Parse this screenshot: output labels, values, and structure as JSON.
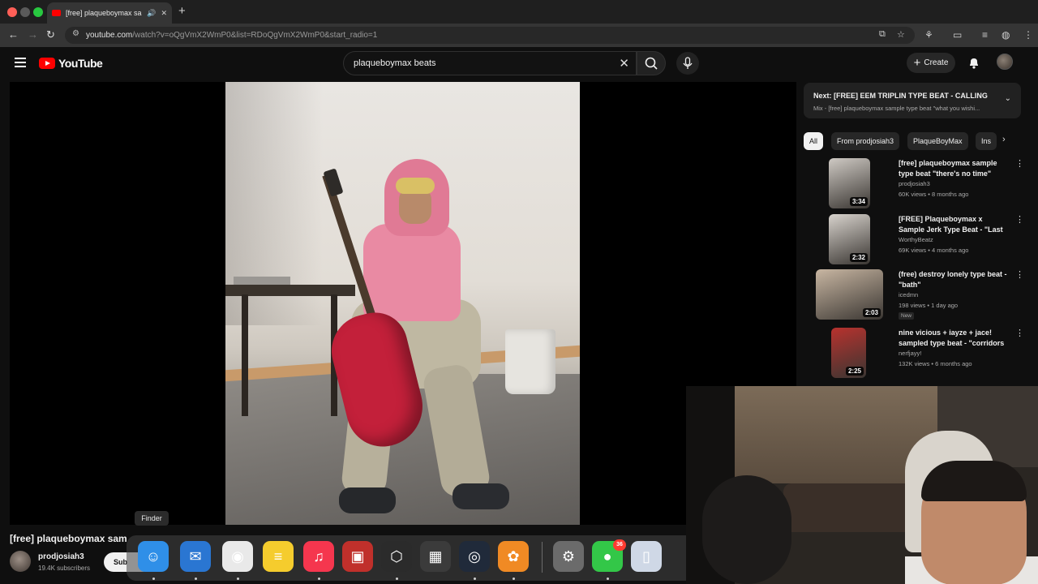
{
  "browser": {
    "tab_title": "[free] plaqueboymax sam",
    "url_host": "youtube.com",
    "url_path": "/watch?v=oQgVmX2WmP0&list=RDoQgVmX2WmP0&start_radio=1"
  },
  "masthead": {
    "logo_text": "YouTube",
    "search_value": "plaqueboymax beats",
    "create_label": "Create"
  },
  "video": {
    "title_truncated": "[free] plaqueboymax sam",
    "channel": "prodjosiah3",
    "subscribers": "19.4K subscribers",
    "subscribe_label": "Sub"
  },
  "up_next": {
    "title": "Next: [FREE] EEM TRIPLIN TYPE BEAT - CALLING",
    "subtitle": "Mix - [free] plaqueboymax sample type beat \"what you wishi..."
  },
  "chips": [
    "All",
    "From prodjosiah3",
    "PlaqueBoyMax",
    "Ins"
  ],
  "recommendations": [
    {
      "title": "[free] plaqueboymax sample type beat \"there's no time\"",
      "channel": "prodjosiah3",
      "meta": "60K views • 8 months ago",
      "duration": "3:34",
      "thumb_color": "#cfcac4",
      "new": ""
    },
    {
      "title": "[FREE] Plaqueboymax x Sample Jerk Type Beat - \"Last Friday ...",
      "channel": "WorthyBeatz",
      "meta": "69K views • 4 months ago",
      "duration": "2:32",
      "thumb_color": "#d8d3cd",
      "new": ""
    },
    {
      "title": "(free) destroy lonely type beat - \"bath\"",
      "channel": "icedmn",
      "meta": "198 views • 1 day ago",
      "duration": "2:03",
      "thumb_color": "#c8b6a2",
      "new": "New"
    },
    {
      "title": "nine vicious + iayze + jace! sampled type beat - \"corridors ...",
      "channel": "nerfjayy!",
      "meta": "132K views • 6 months ago",
      "duration": "2:25",
      "thumb_color": "#b8322e",
      "new": ""
    }
  ],
  "dock": {
    "tooltip": "Finder",
    "messages_badge": "36",
    "apps": [
      {
        "name": "finder",
        "color": "#2f8fe8",
        "glyph": "☺"
      },
      {
        "name": "mail",
        "color": "#2a76d2",
        "glyph": "✉"
      },
      {
        "name": "chrome",
        "color": "#e9e9e9",
        "glyph": "◉"
      },
      {
        "name": "notes",
        "color": "#f5cc2d",
        "glyph": "≡"
      },
      {
        "name": "music",
        "color": "#f5364e",
        "glyph": "♫"
      },
      {
        "name": "photo-booth",
        "color": "#c0302b",
        "glyph": "▣"
      },
      {
        "name": "unity",
        "color": "#2b2b2b",
        "glyph": "⬡"
      },
      {
        "name": "launchpad",
        "color": "#3b3b3b",
        "glyph": "▦"
      },
      {
        "name": "obs",
        "color": "#202a3a",
        "glyph": "◎"
      },
      {
        "name": "fl-studio",
        "color": "#f08a24",
        "glyph": "✿"
      },
      {
        "name": "system-settings",
        "color": "#6b6b6b",
        "glyph": "⚙"
      },
      {
        "name": "messages",
        "color": "#33c748",
        "glyph": "●"
      },
      {
        "name": "preview",
        "color": "#cfd8e6",
        "glyph": "▯"
      }
    ]
  }
}
